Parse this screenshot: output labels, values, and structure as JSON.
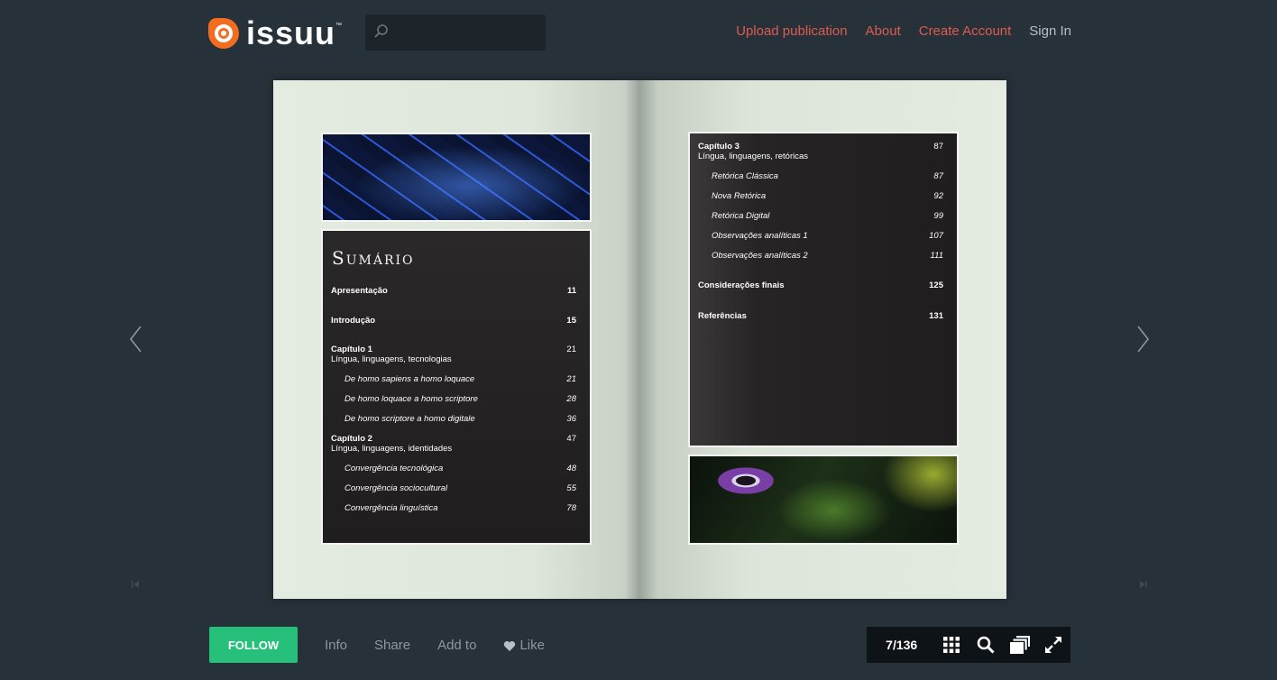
{
  "header": {
    "logo_text": "issuu",
    "logo_tm": "™",
    "search_placeholder": "",
    "nav": {
      "upload": "Upload publication",
      "about": "About",
      "create_account": "Create Account",
      "sign_in": "Sign In"
    }
  },
  "publication": {
    "left_page": {
      "title": "Sumário",
      "entries": [
        {
          "label": "Apresentação",
          "page": "11",
          "style": "bold"
        },
        {
          "label": "Introdução",
          "page": "15",
          "style": "bold"
        },
        {
          "chapter": "Capítulo 1",
          "label": "Língua, linguagens, tecnologias",
          "page": "21",
          "style": "chapter"
        },
        {
          "label": "De homo sapiens a homo loquace",
          "page": "21",
          "style": "sub"
        },
        {
          "label": "De homo loquace a homo scriptore",
          "page": "28",
          "style": "sub"
        },
        {
          "label": "De homo scriptore a homo digitale",
          "page": "36",
          "style": "sub"
        },
        {
          "chapter": "Capítulo 2",
          "label": "Língua, linguagens, identidades",
          "page": "47",
          "style": "chapter"
        },
        {
          "label": "Convergência tecnológica",
          "page": "48",
          "style": "sub"
        },
        {
          "label": "Convergência sociocultural",
          "page": "55",
          "style": "sub"
        },
        {
          "label": "Convergência linguística",
          "page": "78",
          "style": "sub"
        }
      ]
    },
    "right_page": {
      "entries": [
        {
          "chapter": "Capítulo 3",
          "label": "Língua, linguagens, retóricas",
          "page": "87",
          "style": "chapter"
        },
        {
          "label": "Retórica Clássica",
          "page": "87",
          "style": "sub"
        },
        {
          "label": "Nova Retórica",
          "page": "92",
          "style": "sub"
        },
        {
          "label": "Retórica Digital",
          "page": "99",
          "style": "sub"
        },
        {
          "label": "Observações analíticas 1",
          "page": "107",
          "style": "sub"
        },
        {
          "label": "Observações analíticas 2",
          "page": "111",
          "style": "sub"
        },
        {
          "label": "Considerações finais",
          "page": "125",
          "style": "bold"
        },
        {
          "label": "Referências",
          "page": "131",
          "style": "bold"
        }
      ]
    }
  },
  "bottom_bar": {
    "follow": "FOLLOW",
    "info": "Info",
    "share": "Share",
    "add_to": "Add to",
    "like": "Like",
    "page_indicator": "7/136"
  },
  "icons": {
    "logo": "issuu-logo-icon",
    "search": "search-icon",
    "prev": "chevron-left-icon",
    "next": "chevron-right-icon",
    "first": "skip-first-icon",
    "last": "skip-last-icon",
    "like": "heart-icon",
    "grid": "grid-icon",
    "zoom": "magnifier-icon",
    "stack": "stack-icon",
    "fullscreen": "fullscreen-icon"
  },
  "colors": {
    "background": "#263139",
    "nav_link": "#e05a4f",
    "follow": "#27c07a",
    "logo": "#f36d21"
  }
}
